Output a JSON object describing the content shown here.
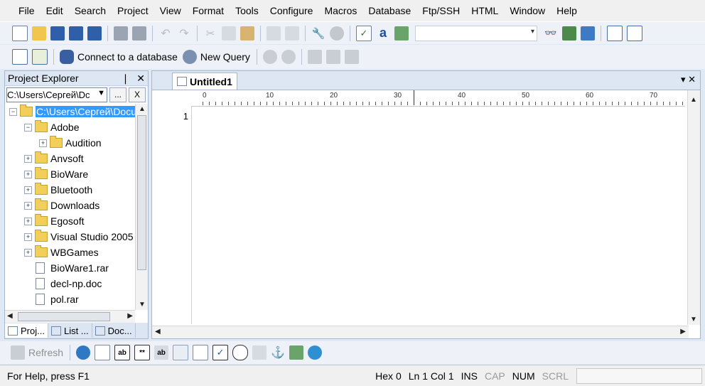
{
  "menu": [
    {
      "label": "File",
      "accel": "F"
    },
    {
      "label": "Edit",
      "accel": "E"
    },
    {
      "label": "Search",
      "accel": ""
    },
    {
      "label": "Project",
      "accel": ""
    },
    {
      "label": "View",
      "accel": "V"
    },
    {
      "label": "Format",
      "accel": ""
    },
    {
      "label": "Tools",
      "accel": ""
    },
    {
      "label": "Configure",
      "accel": ""
    },
    {
      "label": "Macros",
      "accel": ""
    },
    {
      "label": "Database",
      "accel": "D"
    },
    {
      "label": "Ftp/SSH",
      "accel": ""
    },
    {
      "label": "HTML",
      "accel": ""
    },
    {
      "label": "Window",
      "accel": "W"
    },
    {
      "label": "Help",
      "accel": "H"
    }
  ],
  "toolbar2": {
    "connect_label": "Connect to a database",
    "new_query_label": "New Query"
  },
  "explorer": {
    "title": "Project Explorer",
    "pin_glyph": "❘",
    "close_glyph": "✕",
    "path_value": "C:\\Users\\Сергей\\Dc",
    "browse_label": "...",
    "clear_label": "X",
    "tree": [
      {
        "label": "C:\\Users\\Сергей\\Docu",
        "type": "folder",
        "level": 0,
        "expander": "−",
        "selected": true
      },
      {
        "label": "Adobe",
        "type": "folder",
        "level": 1,
        "expander": "−"
      },
      {
        "label": "Audition",
        "type": "folder",
        "level": 2,
        "expander": "+"
      },
      {
        "label": "Anvsoft",
        "type": "folder",
        "level": 1,
        "expander": "+"
      },
      {
        "label": "BioWare",
        "type": "folder",
        "level": 1,
        "expander": "+"
      },
      {
        "label": "Bluetooth",
        "type": "folder",
        "level": 1,
        "expander": "+"
      },
      {
        "label": "Downloads",
        "type": "folder",
        "level": 1,
        "expander": "+"
      },
      {
        "label": "Egosoft",
        "type": "folder",
        "level": 1,
        "expander": "+"
      },
      {
        "label": "Visual Studio 2005",
        "type": "folder",
        "level": 1,
        "expander": "+"
      },
      {
        "label": "WBGames",
        "type": "folder",
        "level": 1,
        "expander": "+"
      },
      {
        "label": "BioWare1.rar",
        "type": "file",
        "level": 1,
        "expander": ""
      },
      {
        "label": "decl-np.doc",
        "type": "file",
        "level": 1,
        "expander": ""
      },
      {
        "label": "pol.rar",
        "type": "file",
        "level": 1,
        "expander": ""
      }
    ],
    "tabs": [
      {
        "label": "Proj...",
        "active": true
      },
      {
        "label": "List ...",
        "active": false
      },
      {
        "label": "Doc...",
        "active": false
      }
    ]
  },
  "editor": {
    "tab_label": "Untitled1",
    "ruler_labels": [
      "0",
      "10",
      "20",
      "30",
      "40",
      "50",
      "60",
      "70"
    ],
    "line_number": "1",
    "controls": "▾ ✕"
  },
  "toolbar3": {
    "refresh_label": "Refresh"
  },
  "status": {
    "help_text": "For Help, press F1",
    "hex_label": "Hex",
    "hex_value": "0",
    "ln_label": "Ln",
    "ln_value": "1",
    "col_label": "Col",
    "col_value": "1",
    "ins": "INS",
    "cap": "CAP",
    "num": "NUM",
    "scrl": "SCRL"
  }
}
